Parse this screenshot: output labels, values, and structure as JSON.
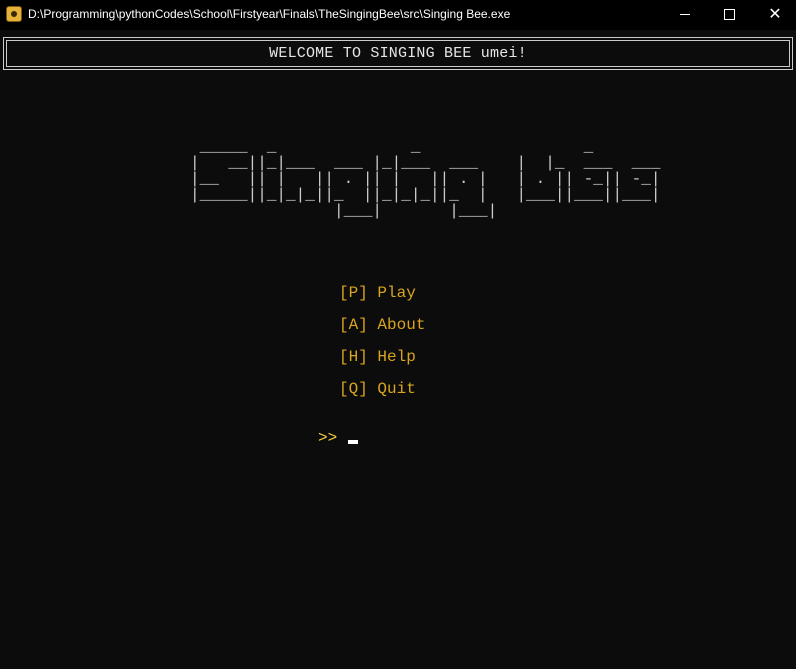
{
  "window": {
    "title": "D:\\Programming\\pythonCodes\\School\\Firstyear\\Finals\\TheSingingBee\\src\\Singing Bee.exe",
    "icon": "bee-app-icon",
    "controls": {
      "minimize": "minimize-icon",
      "maximize": "maximize-icon",
      "close": "close-icon",
      "close_glyph": "✕"
    }
  },
  "banner": {
    "text": "WELCOME TO SINGING BEE umei!"
  },
  "logo": {
    "ascii": " _____  _              _                 _\n|   __||_|___  ___ |_|___  ___    |  |_  ___  ___\n|__   || |   || . || |   || . |   | . || -_|| -_|\n|_____||_|_|_||_  ||_|_|_||_  |   |___||___||___|\n               |___|       |___|"
  },
  "menu": {
    "items": [
      {
        "key": "[P]",
        "label": "Play"
      },
      {
        "key": "[A]",
        "label": "About"
      },
      {
        "key": "[H]",
        "label": "Help"
      },
      {
        "key": "[Q]",
        "label": "Quit"
      }
    ]
  },
  "prompt": {
    "symbol": ">>"
  },
  "colors": {
    "background": "#0c0c0c",
    "menu_text": "#d9a41f",
    "prompt_text": "#f2cf4a",
    "banner_text": "#e6e6e6"
  }
}
